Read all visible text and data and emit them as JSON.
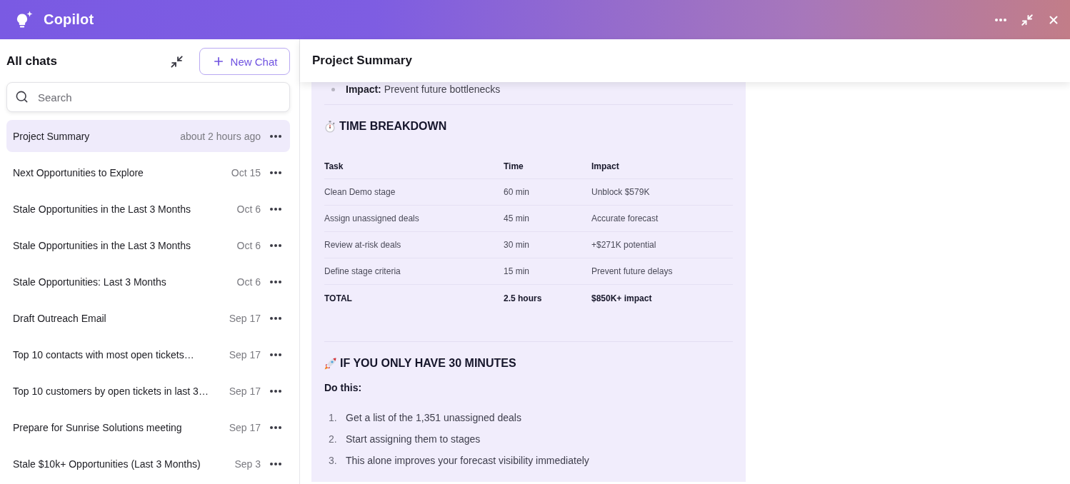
{
  "app_bar": {
    "title": "Copilot"
  },
  "sidebar": {
    "title": "All chats",
    "new_chat": "New Chat",
    "search": {
      "placeholder": "Search"
    },
    "chats": [
      {
        "title": "Project Summary",
        "time": "about 2 hours ago",
        "selected": true
      },
      {
        "title": "Next Opportunities to Explore",
        "time": "Oct 15",
        "selected": false
      },
      {
        "title": "Stale Opportunities in the Last 3 Months",
        "time": "Oct 6",
        "selected": false
      },
      {
        "title": "Stale Opportunities in the Last 3 Months",
        "time": "Oct 6",
        "selected": false
      },
      {
        "title": "Stale Opportunities: Last 3 Months",
        "time": "Oct 6",
        "selected": false
      },
      {
        "title": "Draft Outreach Email",
        "time": "Sep 17",
        "selected": false
      },
      {
        "title": "Top 10 contacts with most open tickets…",
        "time": "Sep 17",
        "selected": false
      },
      {
        "title": "Top 10 customers by open tickets in last 3…",
        "time": "Sep 17",
        "selected": false
      },
      {
        "title": "Prepare for Sunrise Solutions meeting",
        "time": "Sep 17",
        "selected": false
      },
      {
        "title": "Stale $10k+ Opportunities (Last 3 Months)",
        "time": "Sep 3",
        "selected": false
      }
    ]
  },
  "conversation": {
    "title": "Project Summary",
    "bullet": "**Impact:** Prevent future bottlenecks",
    "sections": [
      {
        "kind": "table",
        "heading": "TIME BREAKDOWN",
        "columns": [
          "Task",
          "Time",
          "Impact"
        ],
        "rows": [
          [
            "Clean Demo stage",
            "60 min",
            "Unblock $579K"
          ],
          [
            "Assign unassigned deals",
            "45 min",
            "Accurate forecast"
          ],
          [
            "Review at-risk deals",
            "30 min",
            "+$271K potential"
          ],
          [
            "Define stage criteria",
            "15 min",
            "Prevent future delays"
          ]
        ],
        "total": [
          "TOTAL",
          "2.5 hours",
          "$850K+ impact"
        ]
      },
      {
        "kind": "steps",
        "heading": "IF YOU ONLY HAVE 30 MINUTES",
        "intro": "Do this:",
        "steps": [
          {
            "number": "1.",
            "text": "Get a list of the 1,351 unassigned deals"
          },
          {
            "number": "2.",
            "text": "Start assigning them to stages"
          },
          {
            "number": "3.",
            "text": "This alone improves your forecast visibility immediately"
          }
        ]
      }
    ]
  }
}
